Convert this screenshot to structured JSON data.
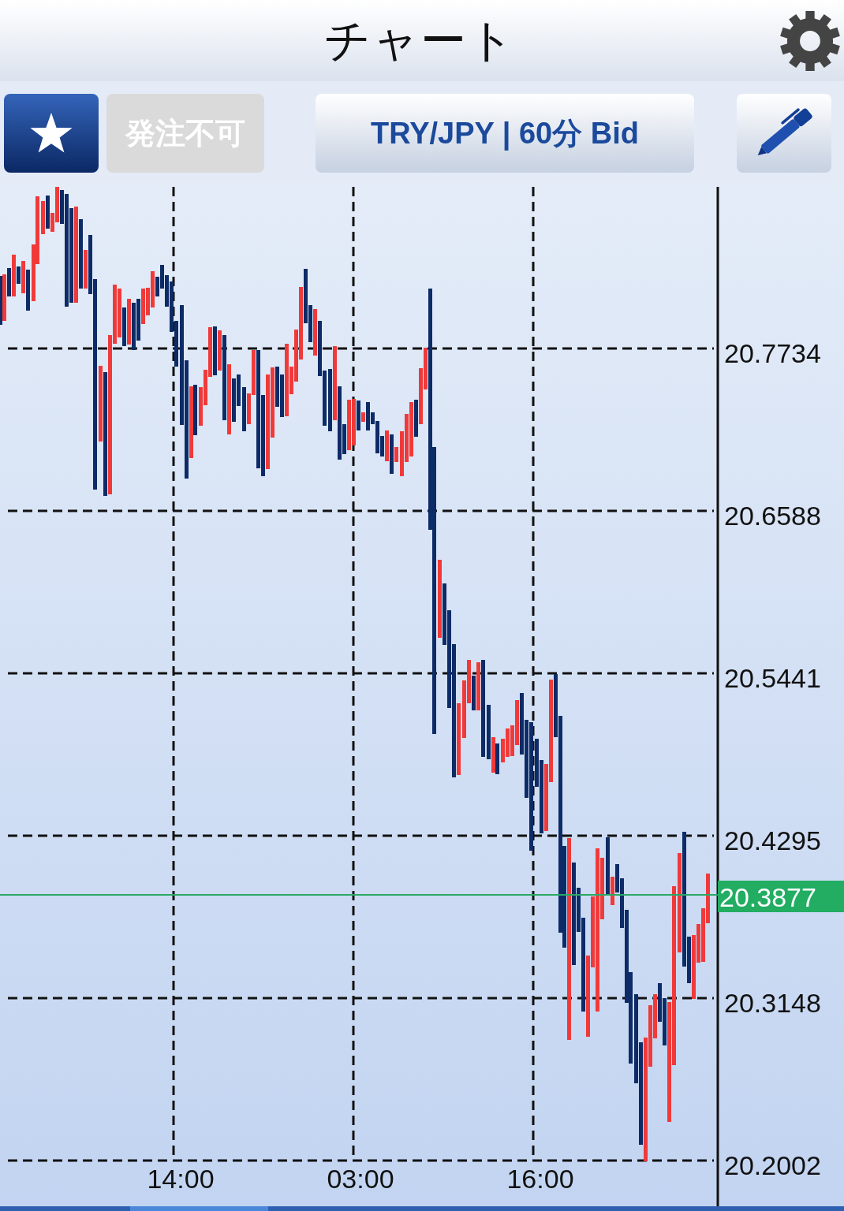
{
  "header": {
    "title": "チャート"
  },
  "toolbar": {
    "order_button": {
      "label": "発注不可",
      "disabled": true
    },
    "symbol_button": {
      "label": "TRY/JPY | 60分 Bid"
    }
  },
  "chart": {
    "price_labels": [
      "20.7734",
      "20.6588",
      "20.5441",
      "20.4295",
      "20.3148",
      "20.2002"
    ],
    "time_labels": [
      "14:00",
      "03:00",
      "16:00"
    ],
    "current_price": "20.3877"
  }
}
